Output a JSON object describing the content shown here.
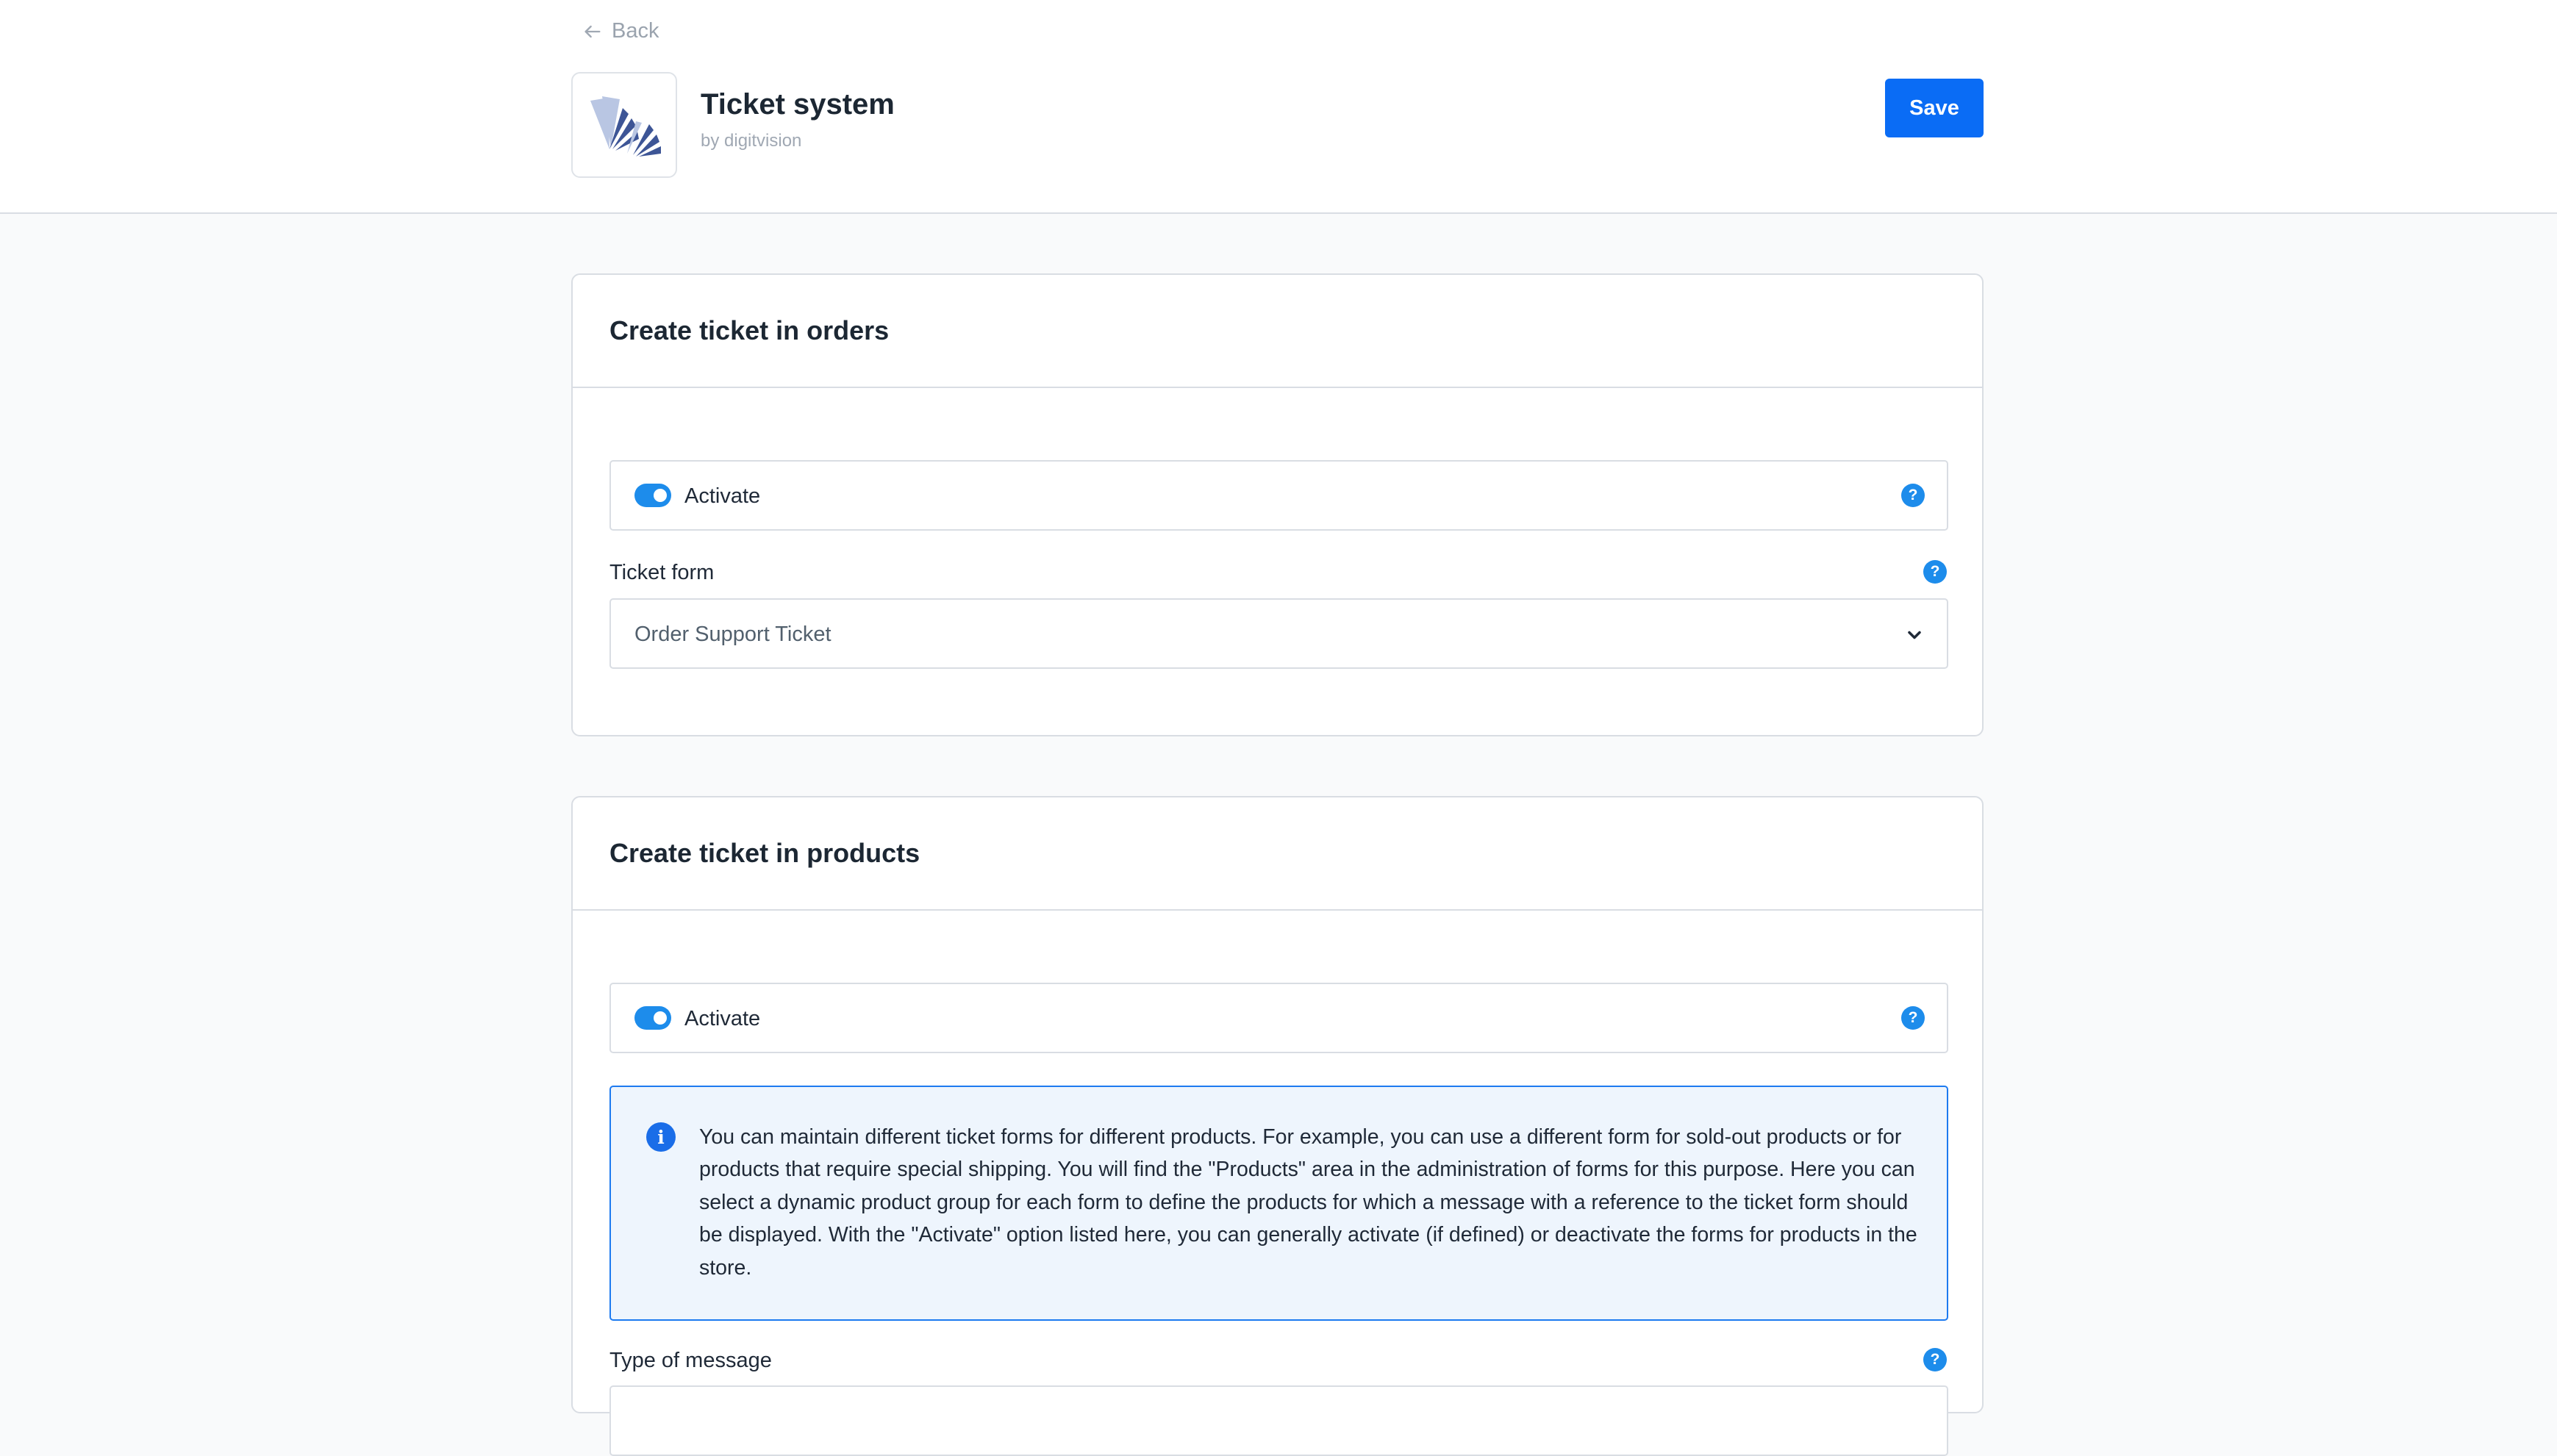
{
  "header": {
    "back_label": "Back",
    "app_title": "Ticket system",
    "app_vendor": "by digitvision",
    "save_label": "Save"
  },
  "orders_card": {
    "title": "Create ticket in orders",
    "activate_label": "Activate",
    "activate_enabled": true,
    "ticket_form_label": "Ticket form",
    "ticket_form_value": "Order Support Ticket"
  },
  "products_card": {
    "title": "Create ticket in products",
    "activate_label": "Activate",
    "activate_enabled": true,
    "info_text": "You can maintain different ticket forms for different products. For example, you can use a different form for sold-out products or for products that require special shipping. You will find the \"Products\" area in the administration of forms for this purpose. Here you can select a dynamic product group for each form to define the products for which a message with a reference to the ticket form should be displayed. With the \"Activate\" option listed here, you can generally activate (if defined) or deactivate the forms for products in the store.",
    "message_type_label": "Type of message"
  },
  "icons": {
    "back": "arrow-left-icon",
    "help": "question-circle-icon",
    "info": "info-circle-icon",
    "dropdown": "chevron-down-icon",
    "logo": "fan-logo"
  },
  "colors": {
    "primary": "#0a6cf5",
    "toggle_on": "#1d8ceb",
    "info_border": "#1d7af0",
    "info_background": "#eef5fd"
  }
}
